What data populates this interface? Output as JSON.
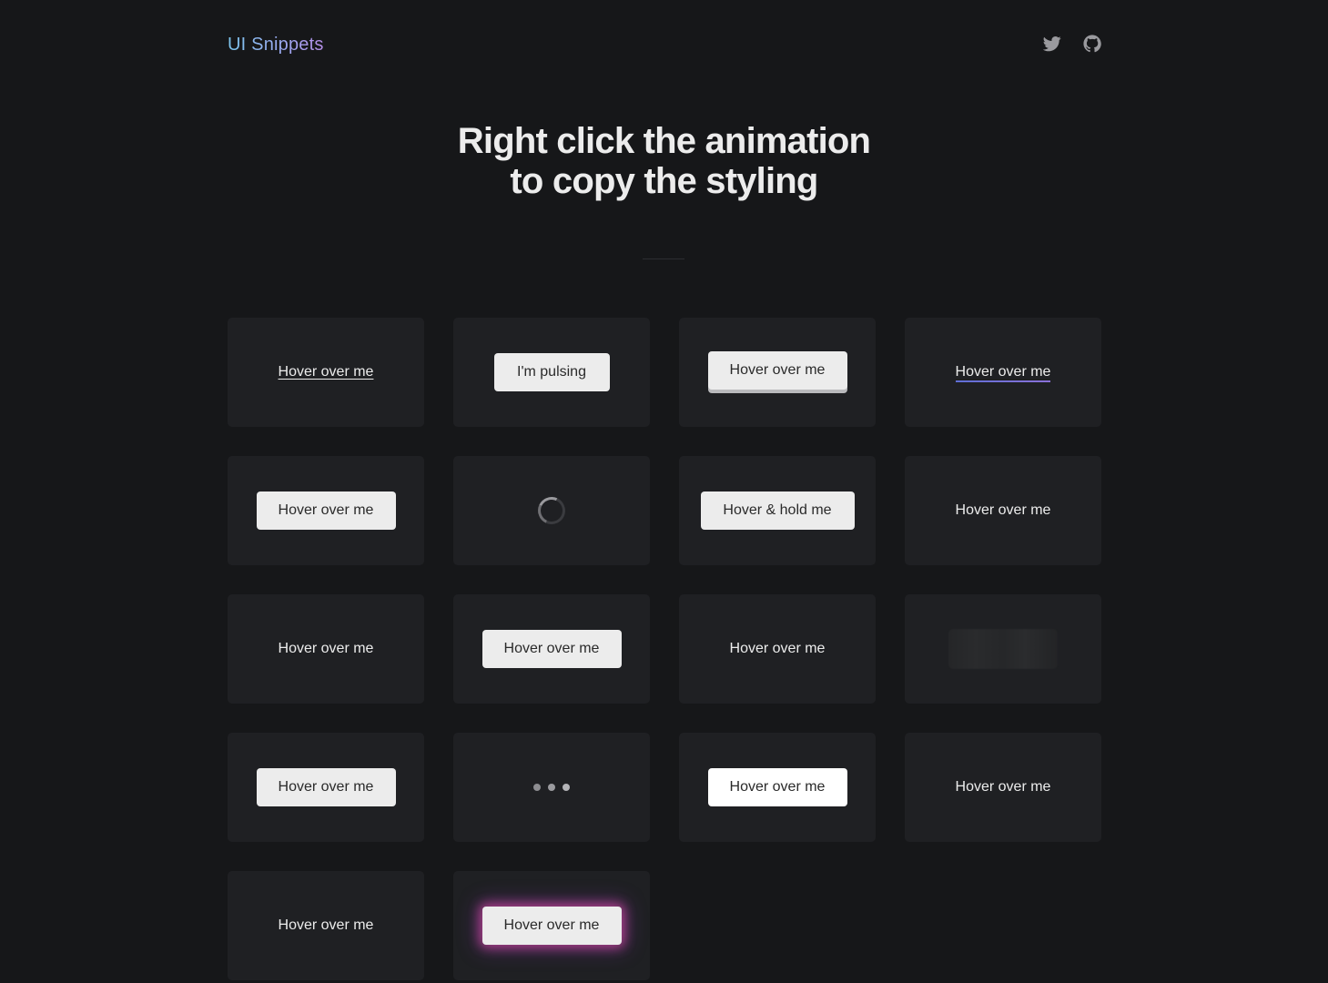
{
  "header": {
    "logo": "UI Snippets",
    "icons": [
      "twitter-icon",
      "github-icon"
    ]
  },
  "hero": {
    "line1": "Right click the animation",
    "line2": "to copy the styling"
  },
  "cards": [
    {
      "label": "Hover over me"
    },
    {
      "label": "I'm pulsing"
    },
    {
      "label": "Hover over me"
    },
    {
      "label": "Hover over me"
    },
    {
      "label": "Hover over me"
    },
    {
      "label": ""
    },
    {
      "label": "Hover & hold me"
    },
    {
      "label": "Hover over me"
    },
    {
      "label": "Hover over me"
    },
    {
      "label": "Hover over me"
    },
    {
      "label": "Hover over me"
    },
    {
      "label": ""
    },
    {
      "label": "Hover over me"
    },
    {
      "label": ""
    },
    {
      "label": "Hover over me"
    },
    {
      "label": "Hover over me"
    },
    {
      "label": "Hover over me"
    },
    {
      "label": "Hover over me"
    }
  ],
  "colors": {
    "background": "#161719",
    "card": "#1f2023",
    "button": "#ececec",
    "logo_gradient": [
      "#7cc4ec",
      "#b58ee8"
    ],
    "glow": "#d648a0"
  }
}
